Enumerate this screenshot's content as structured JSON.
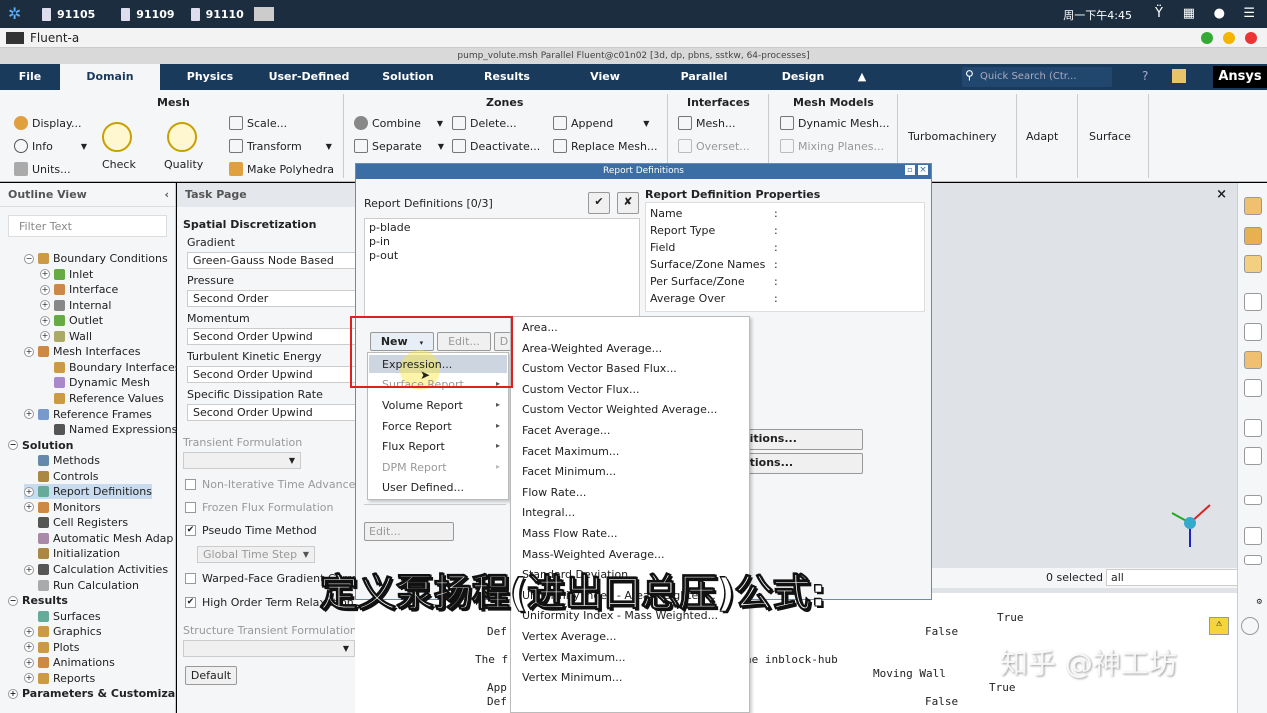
{
  "taskbar": {
    "items": [
      "91105",
      "91109",
      "91110"
    ],
    "clock": "周一下午4:45"
  },
  "app": {
    "title": "Fluent-a",
    "fluent_title": "pump_volute.msh Parallel Fluent@c01n02  [3d, dp, pbns, sstkw, 64-processes]"
  },
  "menubar": {
    "items": [
      "File",
      "Domain",
      "Physics",
      "User-Defined",
      "Solution",
      "Results",
      "View",
      "Parallel",
      "Design"
    ],
    "search_placeholder": "Quick Search (Ctr...",
    "brand": "Ansys"
  },
  "ribbon": {
    "mesh": {
      "title": "Mesh",
      "display": "Display...",
      "info": "Info",
      "units": "Units...",
      "check": "Check",
      "quality": "Quality",
      "scale": "Scale...",
      "transform": "Transform",
      "make_polyhedra": "Make Polyhedra"
    },
    "zones": {
      "title": "Zones",
      "combine": "Combine",
      "separate": "Separate",
      "delete": "Delete...",
      "deactivate": "Deactivate...",
      "append": "Append",
      "replace_mesh": "Replace Mesh..."
    },
    "interfaces": {
      "title": "Interfaces",
      "mesh": "Mesh...",
      "overset": "Overset..."
    },
    "mesh_models": {
      "title": "Mesh Models",
      "dynamic_mesh": "Dynamic Mesh...",
      "mixing_planes": "Mixing Planes..."
    },
    "turbomachinery": "Turbomachinery",
    "adapt": "Adapt",
    "surface": "Surface"
  },
  "outline": {
    "title": "Outline View",
    "filter_placeholder": "Filter Text",
    "rows": [
      "Boundary Conditions",
      "Inlet",
      "Interface",
      "Internal",
      "Outlet",
      "Wall",
      "Mesh Interfaces",
      "Boundary Interfaces",
      "Dynamic Mesh",
      "Reference Values",
      "Reference Frames",
      "Named Expressions",
      "Solution",
      "Methods",
      "Controls",
      "Report Definitions",
      "Monitors",
      "Cell Registers",
      "Automatic Mesh Adap",
      "Initialization",
      "Calculation Activities",
      "Run Calculation",
      "Results",
      "Surfaces",
      "Graphics",
      "Plots",
      "Animations",
      "Reports",
      "Parameters & Customiza"
    ]
  },
  "taskpage": {
    "title": "Task Page",
    "section": "Spatial Discretization",
    "gradient_label": "Gradient",
    "gradient_value": "Green-Gauss Node Based",
    "pressure_label": "Pressure",
    "pressure_value": "Second Order",
    "momentum_label": "Momentum",
    "momentum_value": "Second Order Upwind",
    "tke_label": "Turbulent Kinetic Energy",
    "tke_value": "Second Order Upwind",
    "sdr_label": "Specific Dissipation Rate",
    "sdr_value": "Second Order Upwind",
    "transient_label": "Transient Formulation",
    "non_iter": "Non-Iterative Time Advancement",
    "frozen_flux": "Frozen Flux Formulation",
    "pseudo_time": "Pseudo Time Method",
    "global_time_step": "Global Time Step",
    "warped_face": "Warped-Face Gradient Correction",
    "high_order": "High Order Term Relaxation",
    "structure_label": "Structure Transient Formulation",
    "default_button": "Default"
  },
  "dialog": {
    "title": "Report Definitions",
    "list_label": "Report Definitions  [0/3]",
    "items": [
      "p-blade",
      "p-in",
      "p-out"
    ],
    "props_title": "Report Definition Properties",
    "props": [
      "Name",
      "Report Type",
      "Field",
      "Surface/Zone Names",
      "Per Surface/Zone",
      "Average Over"
    ],
    "new_button": "New",
    "edit_button": "Edit...",
    "d_button": "D",
    "edit_bottom": "Edit...",
    "definitions_btn1": "initions...",
    "definitions_btn2": "nitions..."
  },
  "menu1": {
    "items": [
      "Expression...",
      "Surface Report",
      "Volume Report",
      "Force Report",
      "Flux Report",
      "DPM Report",
      "User Defined..."
    ]
  },
  "menu2": {
    "items": [
      "Area...",
      "Area-Weighted Average...",
      "Custom Vector Based Flux...",
      "Custom Vector Flux...",
      "Custom Vector Weighted Average...",
      "Facet Average...",
      "Facet Maximum...",
      "Facet Minimum...",
      "Flow Rate...",
      "Integral...",
      "Mass Flow Rate...",
      "Mass-Weighted Average...",
      "Standard Deviation...",
      "Uniformity Index - Area Weighted...",
      "Uniformity Index - Mass Weighted...",
      "Vertex Average...",
      "Vertex Maximum...",
      "Vertex Minimum..."
    ]
  },
  "selection": {
    "count": "0 selected",
    "filter": "all"
  },
  "console": {
    "lines": [
      "True",
      "Def",
      "False",
      "The f",
      "he inblock-hub",
      "Moving Wall",
      "App",
      "True",
      "Def",
      "False"
    ]
  },
  "subtitle": "定义泵扬程(进出口总压)公式:",
  "watermark": "知乎 @神工坊"
}
